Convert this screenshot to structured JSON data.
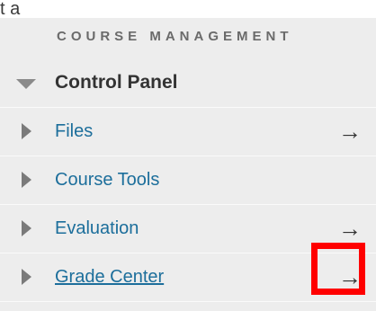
{
  "fragment_text": "t a",
  "panel": {
    "heading": "COURSE MANAGEMENT",
    "control_panel": "Control Panel",
    "items": [
      {
        "label": "Files",
        "arrow": "→",
        "underlined": false
      },
      {
        "label": "Course Tools",
        "arrow": "",
        "underlined": false
      },
      {
        "label": "Evaluation",
        "arrow": "→",
        "underlined": false
      },
      {
        "label": "Grade Center",
        "arrow": "→",
        "underlined": true
      }
    ]
  },
  "colors": {
    "link": "#1c6e9b",
    "highlight": "#ff0000",
    "panel_bg": "#ededed"
  }
}
